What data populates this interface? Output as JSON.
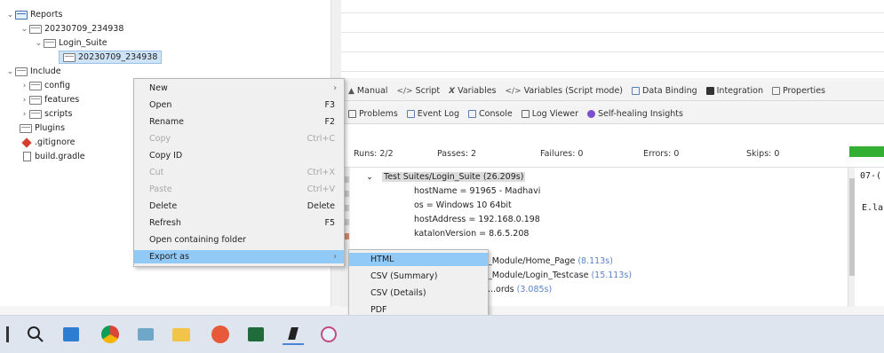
{
  "explorer": {
    "items": [
      {
        "label": "Reports",
        "twisty": "⌄"
      },
      {
        "label": "20230709_234938",
        "twisty": "⌄"
      },
      {
        "label": "Login_Suite",
        "twisty": "⌄"
      },
      {
        "label": "20230709_234938",
        "twisty": ""
      },
      {
        "label": "Include",
        "twisty": "⌄"
      },
      {
        "label": "config",
        "twisty": "›"
      },
      {
        "label": "features",
        "twisty": "›"
      },
      {
        "label": "scripts",
        "twisty": "›"
      },
      {
        "label": "Plugins",
        "twisty": ""
      },
      {
        "label": ".gitignore",
        "twisty": ""
      },
      {
        "label": "build.gradle",
        "twisty": ""
      }
    ]
  },
  "editor_tabs": [
    {
      "label": "Manual",
      "icon": "manual-icon"
    },
    {
      "label": "Script",
      "icon": "script-icon"
    },
    {
      "label": "Variables",
      "icon": "variables-icon"
    },
    {
      "label": "Variables (Script mode)",
      "icon": "variables-script-icon"
    },
    {
      "label": "Data Binding",
      "icon": "data-binding-icon"
    },
    {
      "label": "Integration",
      "icon": "integration-icon"
    },
    {
      "label": "Properties",
      "icon": "properties-icon"
    }
  ],
  "panel_tabs": [
    {
      "label": "Problems",
      "icon": "problems-icon"
    },
    {
      "label": "Event Log",
      "icon": "event-log-icon"
    },
    {
      "label": "Console",
      "icon": "console-icon"
    },
    {
      "label": "Log Viewer",
      "icon": "log-viewer-icon"
    },
    {
      "label": "Self-healing Insights",
      "icon": "self-healing-icon"
    }
  ],
  "stats": {
    "runs": "Runs: 2/2",
    "passes": "Passes: 2",
    "failures": "Failures: 0",
    "errors": "Errors: 0",
    "skips": "Skips: 0",
    "progress": 1.0
  },
  "log": {
    "suite_path": "Test Suites/Login_Suite",
    "suite_duration": "(26.209s)",
    "lines": [
      "hostName = 91965 - Madhavi",
      "os = Windows 10 64bit",
      "hostAddress = 192.168.0.198",
      "katalonVersion = 8.6.5.208"
    ],
    "cases": [
      {
        "name": "_Module/Home_Page",
        "duration": "(8.113s)"
      },
      {
        "name": "_Module/Login_Testcase",
        "duration": "(15.113s)"
      },
      {
        "name": "...ords",
        "duration": "(3.085s)"
      }
    ],
    "side_top": "07-(",
    "side_mid": "E.lap"
  },
  "context_menu": {
    "items": [
      {
        "label": "New",
        "shortcut": "",
        "submenu": true,
        "disabled": false
      },
      {
        "label": "Open",
        "shortcut": "F3",
        "submenu": false,
        "disabled": false
      },
      {
        "label": "Rename",
        "shortcut": "F2",
        "submenu": false,
        "disabled": false
      },
      {
        "label": "Copy",
        "shortcut": "Ctrl+C",
        "submenu": false,
        "disabled": true
      },
      {
        "label": "Copy ID",
        "shortcut": "",
        "submenu": false,
        "disabled": false
      },
      {
        "label": "Cut",
        "shortcut": "Ctrl+X",
        "submenu": false,
        "disabled": true
      },
      {
        "label": "Paste",
        "shortcut": "Ctrl+V",
        "submenu": false,
        "disabled": true
      },
      {
        "label": "Delete",
        "shortcut": "Delete",
        "submenu": false,
        "disabled": false
      },
      {
        "label": "Refresh",
        "shortcut": "F5",
        "submenu": false,
        "disabled": false
      },
      {
        "label": "Open containing folder",
        "shortcut": "",
        "submenu": false,
        "disabled": false
      },
      {
        "label": "Export as",
        "shortcut": "",
        "submenu": true,
        "disabled": false
      }
    ]
  },
  "export_submenu": {
    "items": [
      {
        "label": "HTML"
      },
      {
        "label": "CSV (Summary)"
      },
      {
        "label": "CSV (Details)"
      },
      {
        "label": "PDF"
      }
    ]
  },
  "taskbar": {
    "apps": [
      "start-icon",
      "search-icon",
      "file-explorer-icon",
      "chrome-icon",
      "terminal-icon",
      "folder-icon",
      "firefox-icon",
      "photos-icon",
      "katalon-icon",
      "paint-icon"
    ]
  },
  "colors": {
    "selection": "#cfe3f7",
    "menu_hover": "#91c9f7",
    "progress_green": "#33b033",
    "link_blue": "#5a82c7"
  }
}
